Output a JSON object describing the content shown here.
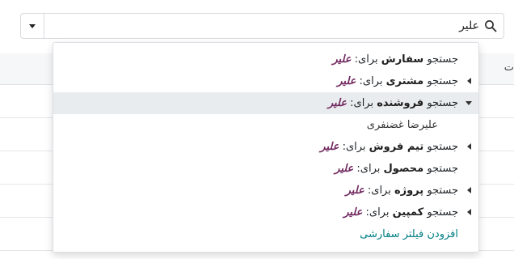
{
  "search": {
    "value": "علیر"
  },
  "table_header": {
    "partial_label": "ت"
  },
  "dropdown": {
    "items": [
      {
        "prefix": "جستجو ",
        "field": "سفارش",
        "suffix": " برای: ",
        "term": "علیر",
        "expandable": false
      },
      {
        "prefix": "جستجو ",
        "field": "مشتری",
        "suffix": " برای: ",
        "term": "علیر",
        "expandable": true
      },
      {
        "prefix": "جستجو ",
        "field": "فروشنده",
        "suffix": " برای: ",
        "term": "علیر",
        "expandable": true,
        "expanded": true
      },
      {
        "prefix": "جستجو ",
        "field": "تیم فروش",
        "suffix": " برای: ",
        "term": "علیر",
        "expandable": true
      },
      {
        "prefix": "جستجو ",
        "field": "محصول",
        "suffix": " برای: ",
        "term": "علیر",
        "expandable": false
      },
      {
        "prefix": "جستجو ",
        "field": "پروژه",
        "suffix": " برای: ",
        "term": "علیر",
        "expandable": true
      },
      {
        "prefix": "جستجو ",
        "field": "کمپین",
        "suffix": " برای: ",
        "term": "علیر",
        "expandable": true
      }
    ],
    "subitem": "علیرضا غضنفری",
    "custom_filter": "افزودن فیلتر سفارشی"
  },
  "colors": {
    "term": "#71285f",
    "link": "#017e84",
    "active_bg": "#e9ecef"
  }
}
